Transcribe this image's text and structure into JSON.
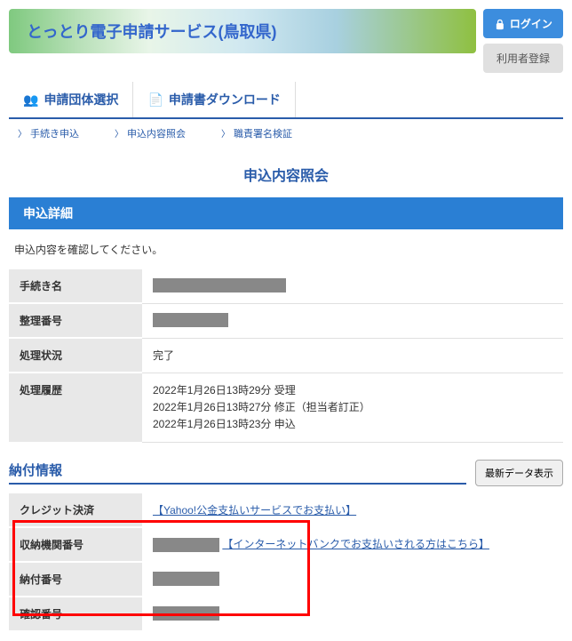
{
  "banner": {
    "title": "とっとり電子申請サービス(鳥取県)"
  },
  "auth": {
    "login": "ログイン",
    "register": "利用者登録"
  },
  "nav": {
    "tab1": "申請団体選択",
    "tab2": "申請書ダウンロード"
  },
  "breadcrumb": {
    "b1": "手続き申込",
    "b2": "申込内容照会",
    "b3": "職責署名検証"
  },
  "page_title": "申込内容照会",
  "section1_title": "申込詳細",
  "instruction": "申込内容を確認してください。",
  "details": {
    "row1_label": "手続き名",
    "row2_label": "整理番号",
    "row3_label": "処理状況",
    "row3_value": "完了",
    "row4_label": "処理履歴",
    "history": {
      "h1": "2022年1月26日13時29分 受理",
      "h2": "2022年1月26日13時27分 修正（担当者訂正）",
      "h3": "2022年1月26日13時23分 申込"
    }
  },
  "payment": {
    "section_title": "納付情報",
    "refresh_btn": "最新データ表示",
    "row1_label": "クレジット決済",
    "row1_link": "【Yahoo!公金支払いサービスでお支払い】",
    "row2_label": "収納機関番号",
    "row2_link": "【インターネットバンクでお支払いされる方はこちら】",
    "row3_label": "納付番号",
    "row4_label": "確認番号"
  }
}
